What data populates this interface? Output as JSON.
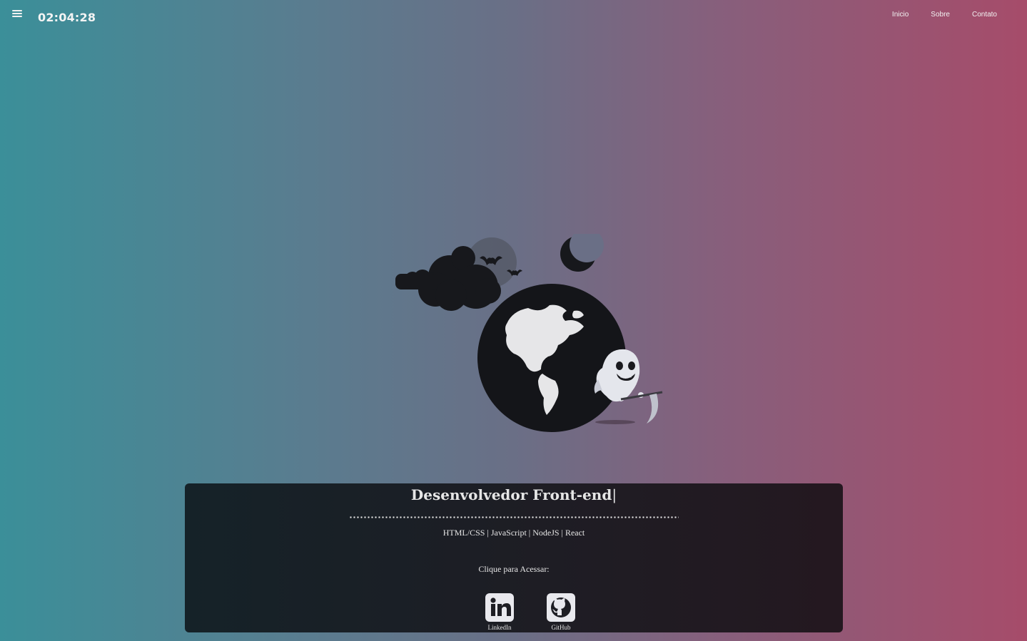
{
  "header": {
    "menu_icon": "hamburger-icon",
    "clock": "02:04:28",
    "nav": [
      {
        "label": "Inicio"
      },
      {
        "label": "Sobre"
      },
      {
        "label": "Contato"
      }
    ]
  },
  "hero": {
    "illustration": "globe-ghost-reaper-illustration"
  },
  "card": {
    "title": "Desenvolvedor Front-end",
    "caret": "|",
    "skills": "HTML/CSS | JavaScript | NodeJS | React",
    "cta": "Clique para Acessar:",
    "links": [
      {
        "label": "LinkedIn",
        "icon": "linkedin-icon"
      },
      {
        "label": "GitHub",
        "icon": "github-icon"
      }
    ]
  },
  "colors": {
    "gradient_left": "#3b8f99",
    "gradient_right": "#a64c6a",
    "card_bg": "#1b1f26"
  }
}
